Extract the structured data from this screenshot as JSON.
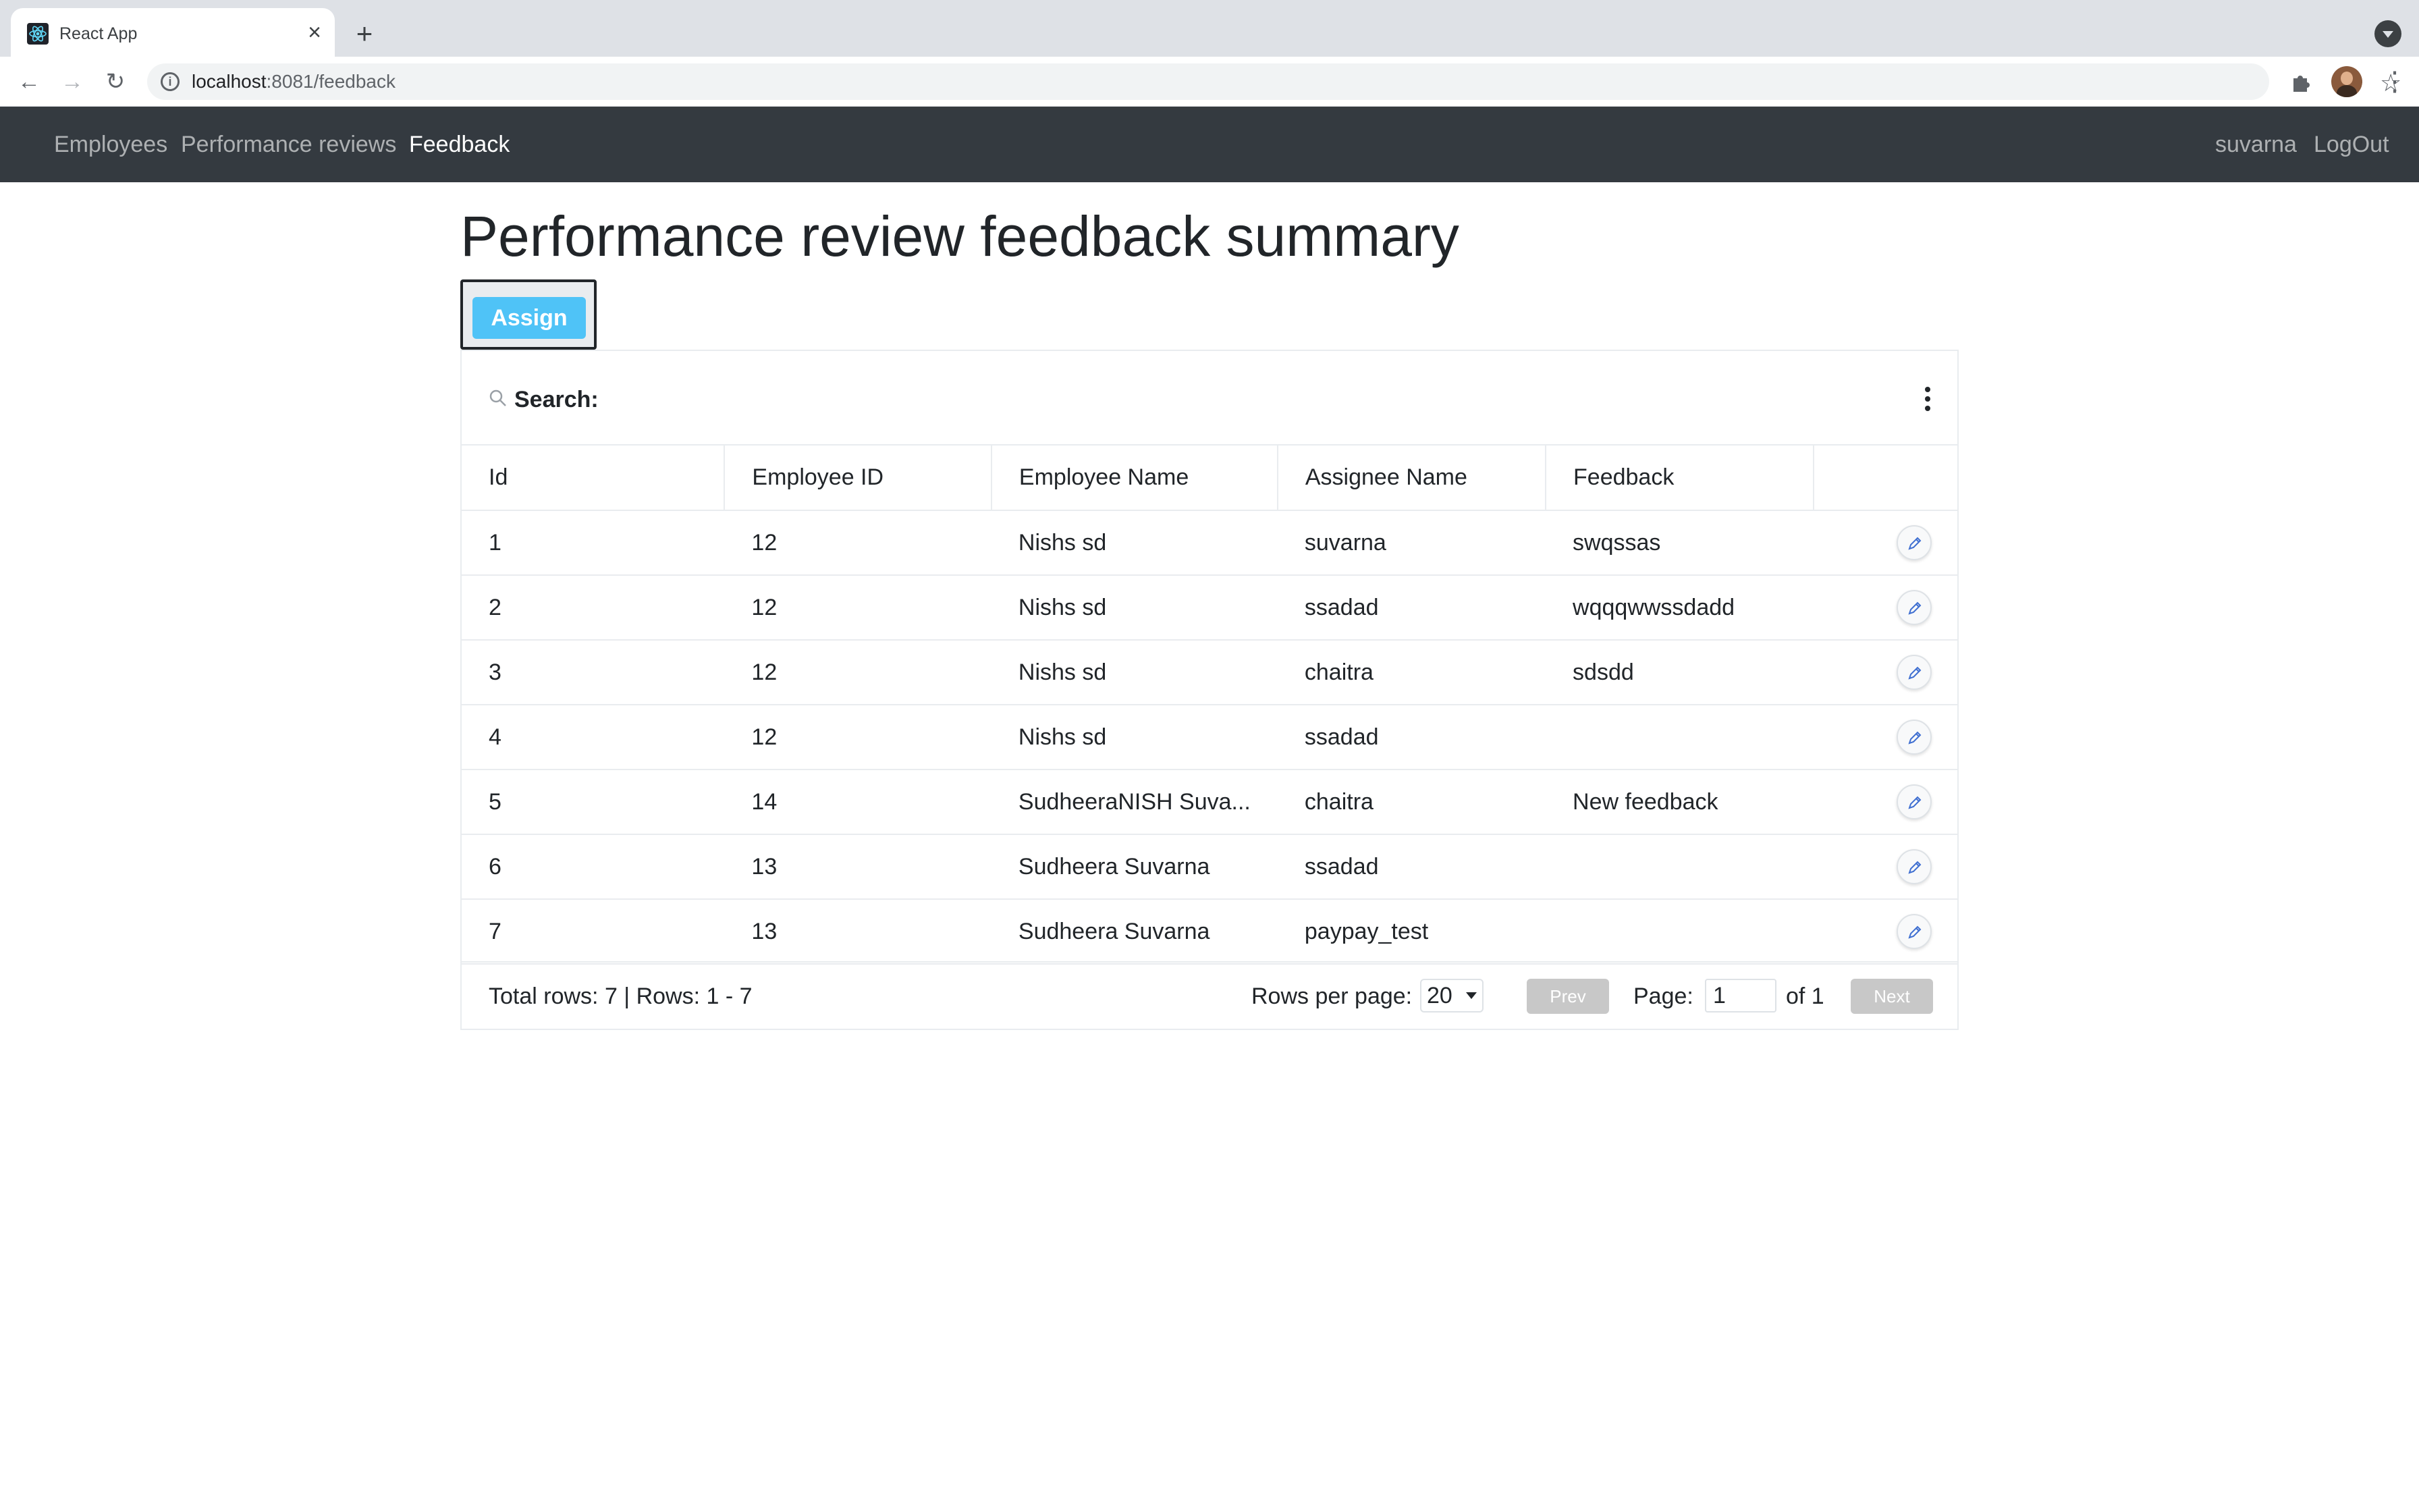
{
  "browser": {
    "tab_title": "React App",
    "url_host": "localhost",
    "url_path": ":8081/feedback"
  },
  "navbar": {
    "links": [
      "Employees",
      "Performance reviews",
      "Feedback"
    ],
    "active": "Feedback",
    "user": "suvarna",
    "logout": "LogOut"
  },
  "page": {
    "title": "Performance review feedback summary",
    "assign_label": "Assign"
  },
  "grid": {
    "search_label": "Search:",
    "columns": [
      "Id",
      "Employee ID",
      "Employee Name",
      "Assignee Name",
      "Feedback"
    ],
    "rows": [
      {
        "id": "1",
        "employee_id": "12",
        "employee_name": "Nishs sd",
        "assignee": "suvarna",
        "feedback": "swqssas"
      },
      {
        "id": "2",
        "employee_id": "12",
        "employee_name": "Nishs sd",
        "assignee": "ssadad",
        "feedback": "wqqqwwssdadd"
      },
      {
        "id": "3",
        "employee_id": "12",
        "employee_name": "Nishs sd",
        "assignee": "chaitra",
        "feedback": "sdsdd"
      },
      {
        "id": "4",
        "employee_id": "12",
        "employee_name": "Nishs sd",
        "assignee": "ssadad",
        "feedback": ""
      },
      {
        "id": "5",
        "employee_id": "14",
        "employee_name": "SudheeraNISH Suva...",
        "assignee": "chaitra",
        "feedback": "New feedback"
      },
      {
        "id": "6",
        "employee_id": "13",
        "employee_name": "Sudheera Suvarna",
        "assignee": "ssadad",
        "feedback": ""
      },
      {
        "id": "7",
        "employee_id": "13",
        "employee_name": "Sudheera Suvarna",
        "assignee": "paypay_test",
        "feedback": ""
      }
    ]
  },
  "footer": {
    "total_text": "Total rows: 7 | Rows: 1 - 7",
    "rows_per_page_label": "Rows per page:",
    "rows_per_page_value": "20",
    "prev_label": "Prev",
    "page_label": "Page:",
    "page_value": "1",
    "of_text": "of 1",
    "next_label": "Next"
  },
  "colors": {
    "navbar_bg": "#343a40",
    "assign_bg": "#4fc3f7",
    "disabled_btn": "#c8c8c8"
  }
}
